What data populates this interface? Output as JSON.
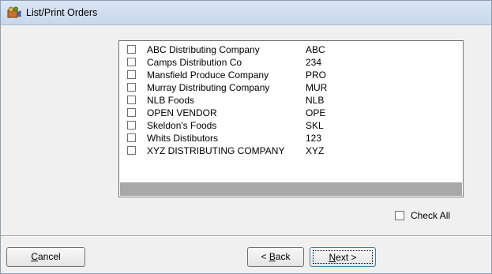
{
  "window": {
    "title": "List/Print Orders",
    "title_icon": "app-icon"
  },
  "vendors": [
    {
      "name": "ABC Distributing Company",
      "code": "ABC",
      "checked": false
    },
    {
      "name": "Camps Distribution Co",
      "code": "234",
      "checked": false
    },
    {
      "name": "Mansfield Produce Company",
      "code": "PRO",
      "checked": false
    },
    {
      "name": "Murray Distributing Company",
      "code": "MUR",
      "checked": false
    },
    {
      "name": "NLB Foods",
      "code": "NLB",
      "checked": false
    },
    {
      "name": "OPEN VENDOR",
      "code": "OPE",
      "checked": false
    },
    {
      "name": "Skeldon's Foods",
      "code": "SKL",
      "checked": false
    },
    {
      "name": "Whits Distibutors",
      "code": "123",
      "checked": false
    },
    {
      "name": "XYZ DISTRIBUTING COMPANY",
      "code": "XYZ",
      "checked": false
    }
  ],
  "check_all": {
    "label": "Check All",
    "checked": false
  },
  "buttons": {
    "cancel": {
      "first": "C",
      "rest": "ancel"
    },
    "back": {
      "pre": "< ",
      "first": "B",
      "rest": "ack"
    },
    "next": {
      "first": "N",
      "rest": "ext >"
    }
  }
}
